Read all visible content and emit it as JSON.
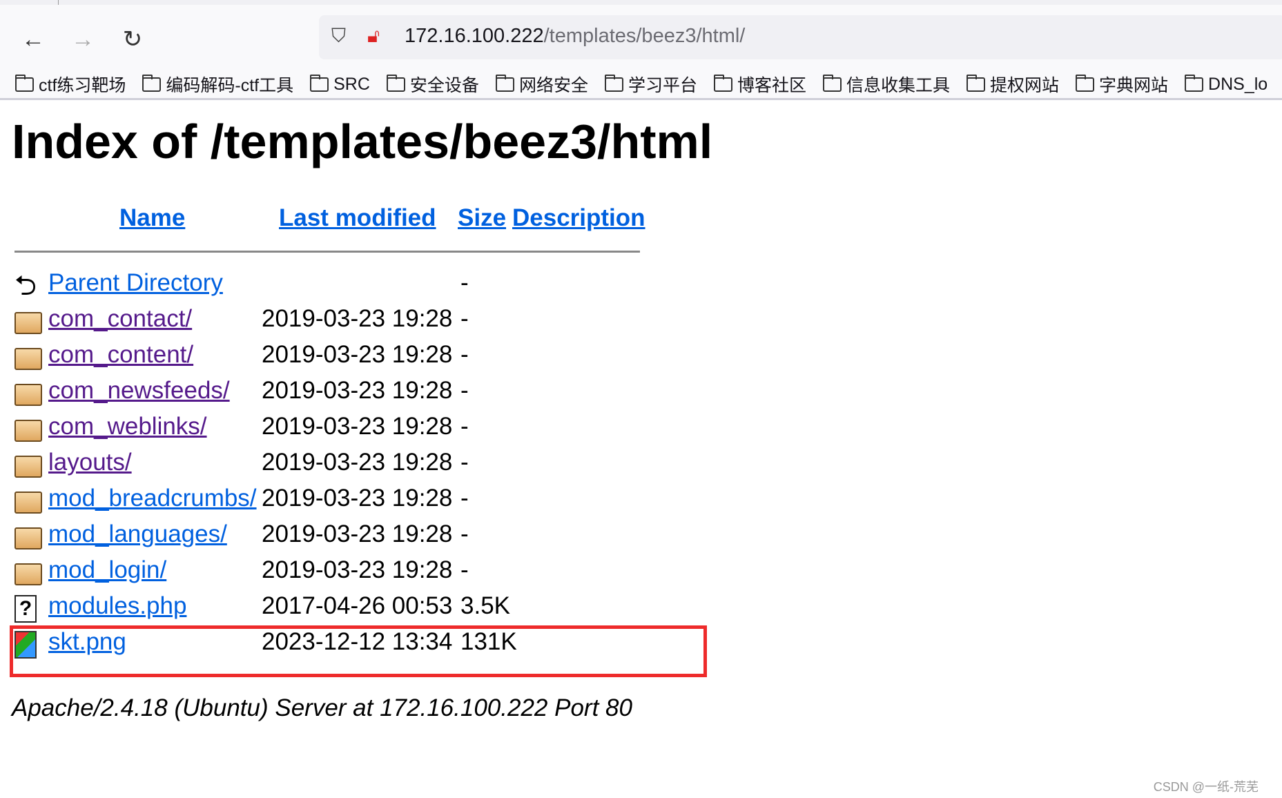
{
  "browser": {
    "url_host": "172.16.100.222",
    "url_path": "/templates/beez3/html/",
    "bookmarks": [
      "ctf练习靶场",
      "编码解码-ctf工具",
      "SRC",
      "安全设备",
      "网络安全",
      "学习平台",
      "博客社区",
      "信息收集工具",
      "提权网站",
      "字典网站",
      "DNS_lo"
    ]
  },
  "page": {
    "title": "Index of /templates/beez3/html",
    "headers": {
      "name": "Name",
      "last_modified": "Last modified",
      "size": "Size",
      "description": "Description"
    },
    "rows": [
      {
        "name": "Parent Directory",
        "date": "",
        "size": "-",
        "icon": "back-icon"
      },
      {
        "name": "com_contact/",
        "date": "2019-03-23 19:28",
        "size": "-",
        "icon": "folder-icon"
      },
      {
        "name": "com_content/",
        "date": "2019-03-23 19:28",
        "size": "-",
        "icon": "folder-icon"
      },
      {
        "name": "com_newsfeeds/",
        "date": "2019-03-23 19:28",
        "size": "-",
        "icon": "folder-icon"
      },
      {
        "name": "com_weblinks/",
        "date": "2019-03-23 19:28",
        "size": "-",
        "icon": "folder-icon"
      },
      {
        "name": "layouts/",
        "date": "2019-03-23 19:28",
        "size": "-",
        "icon": "folder-icon"
      },
      {
        "name": "mod_breadcrumbs/",
        "date": "2019-03-23 19:28",
        "size": "-",
        "icon": "folder-icon"
      },
      {
        "name": "mod_languages/",
        "date": "2019-03-23 19:28",
        "size": "-",
        "icon": "folder-icon"
      },
      {
        "name": "mod_login/",
        "date": "2019-03-23 19:28",
        "size": "-",
        "icon": "folder-icon"
      },
      {
        "name": "modules.php",
        "date": "2017-04-26 00:53",
        "size": "3.5K",
        "icon": "unknown-file-icon"
      },
      {
        "name": "skt.png",
        "date": "2023-12-12 13:34",
        "size": "131K",
        "icon": "image-file-icon"
      }
    ],
    "footer": "Apache/2.4.18 (Ubuntu) Server at 172.16.100.222 Port 80",
    "highlight_color": "#ee2b2b"
  },
  "watermark": "CSDN @一纸-荒芜"
}
